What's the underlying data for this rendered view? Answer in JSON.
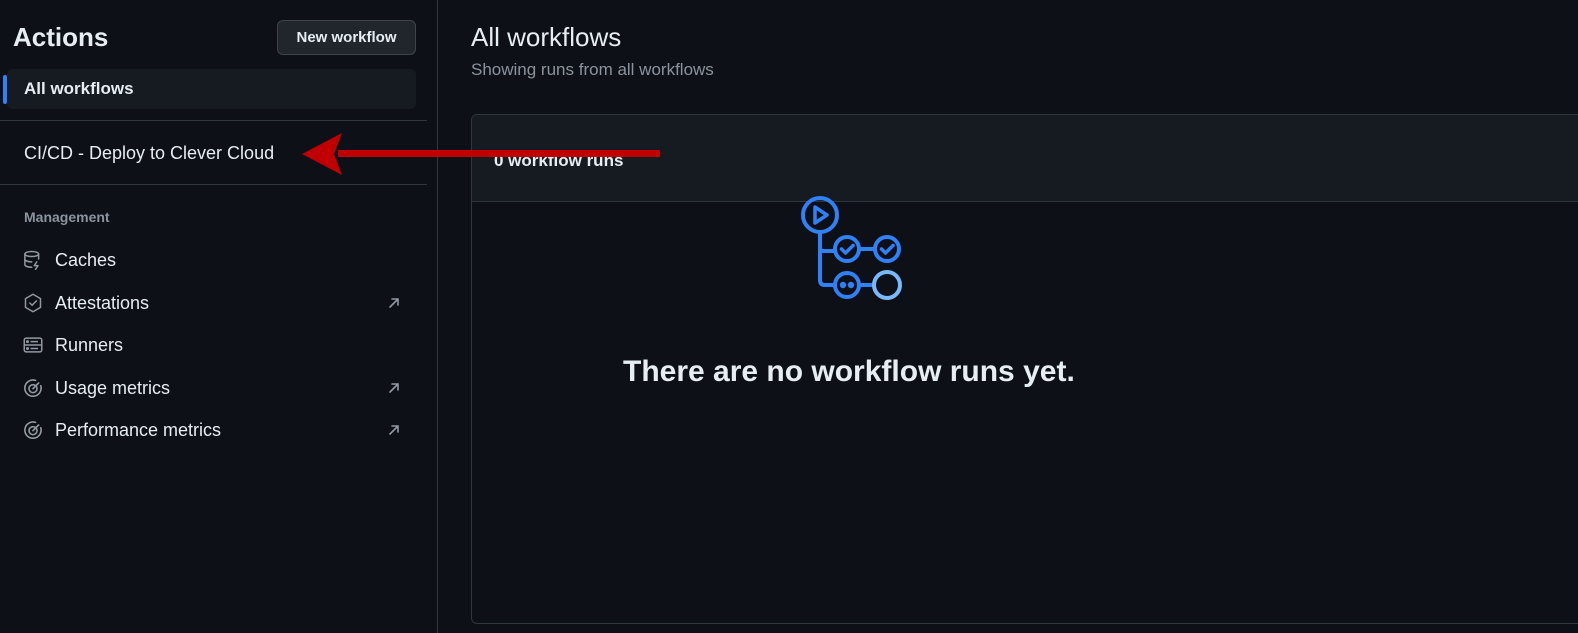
{
  "sidebar": {
    "title": "Actions",
    "new_workflow_label": "New workflow",
    "all_workflows_label": "All workflows",
    "workflows": [
      {
        "label": "CI/CD - Deploy to Clever Cloud"
      }
    ],
    "management": {
      "section_label": "Management",
      "items": [
        {
          "label": "Caches",
          "icon": "database-icon",
          "external": false
        },
        {
          "label": "Attestations",
          "icon": "verified-icon",
          "external": true
        },
        {
          "label": "Runners",
          "icon": "server-icon",
          "external": false
        },
        {
          "label": "Usage metrics",
          "icon": "meter-icon",
          "external": true
        },
        {
          "label": "Performance metrics",
          "icon": "meter-icon",
          "external": true
        }
      ]
    }
  },
  "main": {
    "title": "All workflows",
    "subtitle": "Showing runs from all workflows",
    "runs_count_label": "0 workflow runs",
    "empty_state": {
      "icon": "workflow-icon",
      "message": "There are no workflow runs yet."
    }
  },
  "colors": {
    "background": "#0d1117",
    "accent": "#2f81f7",
    "annotation_arrow": "#c00000"
  }
}
